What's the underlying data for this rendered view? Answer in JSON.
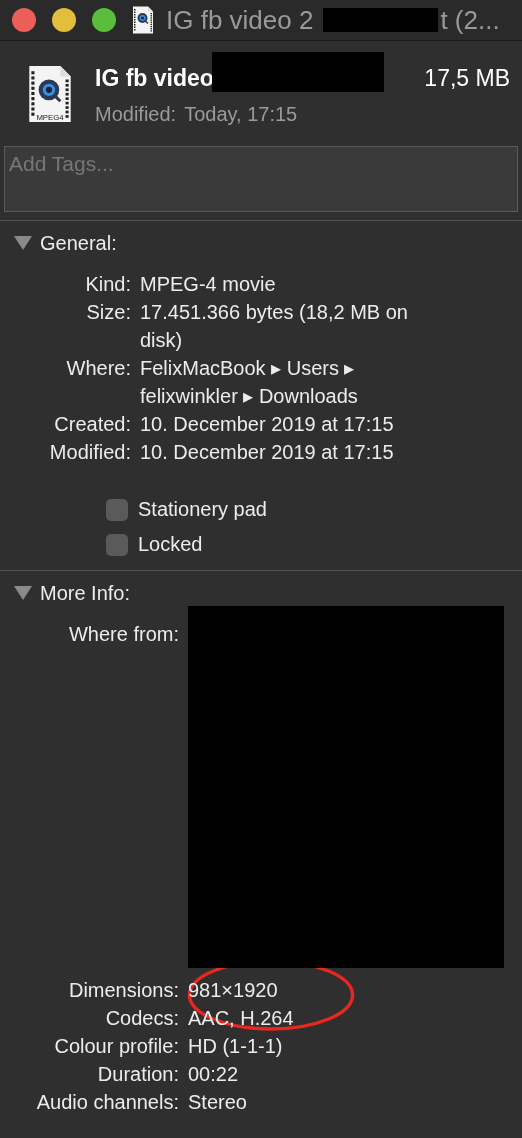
{
  "window": {
    "title_start": "IG fb video 2",
    "title_end": "t (2..."
  },
  "header": {
    "name": "IG fb video",
    "size": "17,5 MB",
    "modified_label": "Modified:",
    "modified_value": "Today, 17:15",
    "icon_caption": "MPEG4"
  },
  "tags": {
    "placeholder": "Add Tags..."
  },
  "sections": [
    {
      "title": "General:",
      "expanded": true,
      "rows": [
        {
          "label": "Kind:",
          "value": "MPEG-4 movie"
        },
        {
          "label": "Size:",
          "value": "17.451.366 bytes (18,2 MB on disk)"
        },
        {
          "label": "Where:",
          "value": "FelixMacBook ▸ Users ▸ felixwinkler ▸ Downloads"
        },
        {
          "label": "Created:",
          "value": "10. December 2019 at 17:15"
        },
        {
          "label": "Modified:",
          "value": "10. December 2019 at 17:15"
        }
      ],
      "checkboxes": [
        {
          "label": "Stationery pad",
          "checked": false
        },
        {
          "label": "Locked",
          "checked": false
        }
      ]
    },
    {
      "title": "More Info:",
      "expanded": true,
      "rows": [
        {
          "label": "Where from:",
          "kind": "redacted"
        },
        {
          "label": "Dimensions:",
          "value": "981×1920"
        },
        {
          "label": "Codecs:",
          "value": "AAC, H.264"
        },
        {
          "label": "Colour profile:",
          "value": "HD (1-1-1)"
        },
        {
          "label": "Duration:",
          "value": "00:22"
        },
        {
          "label": "Audio channels:",
          "value": "Stereo"
        }
      ]
    }
  ]
}
